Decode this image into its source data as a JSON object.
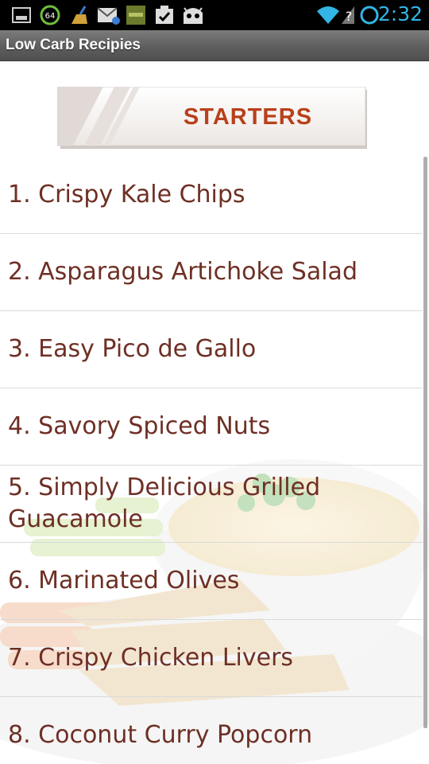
{
  "status_bar": {
    "time": "2:32",
    "notification_count": "64",
    "icons": [
      "screenshot-icon",
      "battery-saver-icon",
      "cleaner-icon",
      "gmail-icon",
      "app-thumbnail-icon",
      "task-check-icon",
      "android-icon",
      "wifi-icon",
      "no-sim-icon",
      "sync-circle-icon"
    ]
  },
  "app": {
    "title": "Low Carb Recipies"
  },
  "banner": {
    "label": "STARTERS"
  },
  "recipes": [
    "1. Crispy Kale Chips",
    "2. Asparagus Artichoke Salad",
    "3. Easy Pico de Gallo",
    "4. Savory Spiced Nuts",
    "5. Simply Delicious Grilled Guacamole",
    "6. Marinated Olives",
    "7. Crispy Chicken Livers",
    "8. Coconut Curry Popcorn"
  ],
  "colors": {
    "accent": "#33b5e5",
    "item_text": "#6e2f24",
    "banner_text": "#b8401b"
  }
}
